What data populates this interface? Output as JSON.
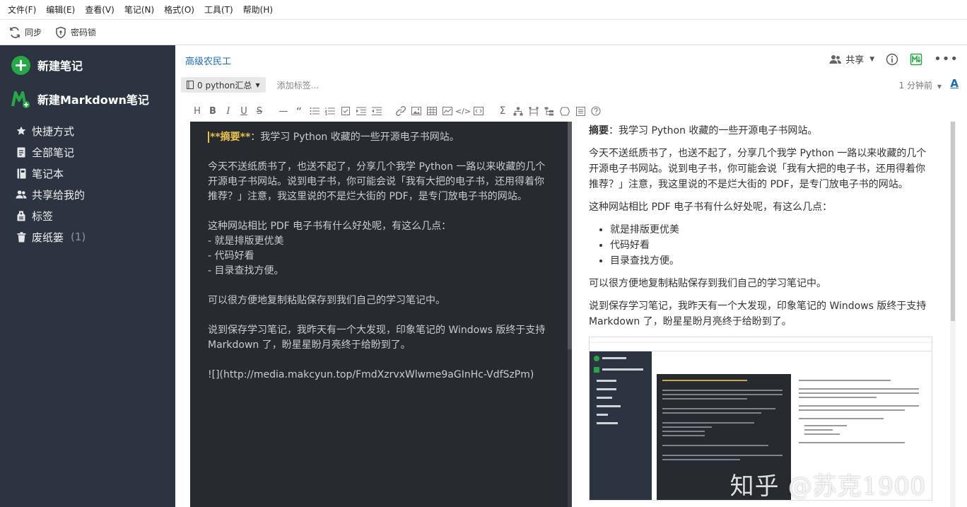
{
  "menu": [
    "文件(F)",
    "编辑(E)",
    "查看(V)",
    "笔记(N)",
    "格式(O)",
    "工具(T)",
    "帮助(H)"
  ],
  "toolbar": {
    "sync": "同步",
    "lock": "密码锁"
  },
  "sidebar": {
    "new_note": "新建笔记",
    "new_markdown": "新建Markdown笔记",
    "items": [
      {
        "label": "快捷方式",
        "icon": "star-icon"
      },
      {
        "label": "全部笔记",
        "icon": "note-icon"
      },
      {
        "label": "笔记本",
        "icon": "notebook-icon"
      },
      {
        "label": "共享给我的",
        "icon": "people-icon"
      },
      {
        "label": "标签",
        "icon": "tag-icon"
      },
      {
        "label": "废纸篓",
        "icon": "trash-icon",
        "count": "(1)"
      }
    ]
  },
  "note": {
    "breadcrumb": "高级农民工",
    "share": "共享",
    "notebook": "0 python汇总",
    "add_tag": "添加标签...",
    "timestamp": "1 分钟前",
    "font_button": "A"
  },
  "editor": {
    "summary_md": "**摘要**",
    "summary_rest": "：我学习 Python 收藏的一些开源电子书网站。",
    "paragraphs": [
      "今天不送纸质书了，也送不起了，分享几个我学 Python 一路以来收藏的几个开源电子书网站。说到电子书，你可能会说「我有大把的电子书，还用得着你推荐？」注意，我这里说的不是烂大街的 PDF，是专门放电子书的网站。",
      "这种网站相比 PDF 电子书有什么好处呢，有这么几点：",
      "可以很方便地复制粘贴保存到我们自己的学习笔记中。",
      "说到保存学习笔记，我昨天有一个大发现，印象笔记的 Windows 版终于支持 Markdown 了，盼星星盼月亮终于给盼到了。",
      "![](http://media.makcyun.top/FmdXzrvxWlwme9aGInHc-VdfSzPm)"
    ],
    "list": [
      "- 就是排版更优美",
      "- 代码好看",
      "- 目录查找方便。"
    ]
  },
  "preview": {
    "summary_label": "摘要",
    "summary_rest": "：我学习 Python 收藏的一些开源电子书网站。",
    "p1": "今天不送纸质书了，也送不起了，分享几个我学 Python 一路以来收藏的几个开源电子书网站。说到电子书，你可能会说「我有大把的电子书，还用得着你推荐？」注意，我这里说的不是烂大街的 PDF，是专门放电子书的网站。",
    "p2": "这种网站相比 PDF 电子书有什么好处呢，有这么几点：",
    "list": [
      "就是排版更优美",
      "代码好看",
      "目录查找方便。"
    ],
    "p3": "可以很方便地复制粘贴保存到我们自己的学习笔记中。",
    "p4": "说到保存学习笔记，我昨天有一个大发现，印象笔记的 Windows 版终于支持 Markdown 了，盼星星盼月亮终于给盼到了。",
    "watermark": "知乎 @苏克1900"
  },
  "colors": {
    "sidebar_bg": "#2b3440",
    "accent_green": "#27a745",
    "link_blue": "#1a6bb8",
    "editor_bg": "#272b30",
    "md_bold": "#e8c24a"
  }
}
